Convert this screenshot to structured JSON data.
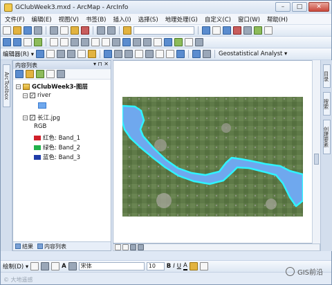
{
  "window": {
    "title": "GClubWeek3.mxd - ArcMap - ArcInfo",
    "minimize": "–",
    "maximize": "□",
    "close": "✕"
  },
  "menu": [
    "文件(F)",
    "编辑(E)",
    "视图(V)",
    "书签(B)",
    "插入(I)",
    "选择(S)",
    "地理处理(G)",
    "自定义(C)",
    "窗口(W)",
    "帮助(H)"
  ],
  "toolbar3": {
    "editor_label": "编辑器(R) ▾",
    "geostat_label": "Geostatistical Analyst ▾"
  },
  "left_dock": {
    "tab": "ArcToolbox"
  },
  "toc": {
    "title": "内容列表",
    "pins": "▾ ⊓ ✕",
    "root": "GClubWeek3-图层",
    "layer1": "river",
    "layer2": "长江.jpg",
    "rgb_label": "RGB",
    "bands": [
      {
        "label": "红色:  Band_1",
        "color": "#d0202a"
      },
      {
        "label": "绿色:  Band_2",
        "color": "#22b14c"
      },
      {
        "label": "蓝色:  Band_3",
        "color": "#1f3ca8"
      }
    ],
    "bottom_tabs": [
      "结果",
      "内容列表"
    ]
  },
  "right_dock": {
    "tabs": [
      "目录",
      "搜索",
      "创建要素"
    ]
  },
  "drawbar": {
    "draw_label": "绘制(D) ▾",
    "font": "宋体",
    "size": "10",
    "bold": "B",
    "italic": "I",
    "underline": "U",
    "font_color": "A"
  },
  "watermark": {
    "text": "GIS前沿",
    "sub": "© 大地遥感"
  },
  "colors": {
    "river": "#6fa8ee",
    "river_edge": "#2ff3ff"
  }
}
